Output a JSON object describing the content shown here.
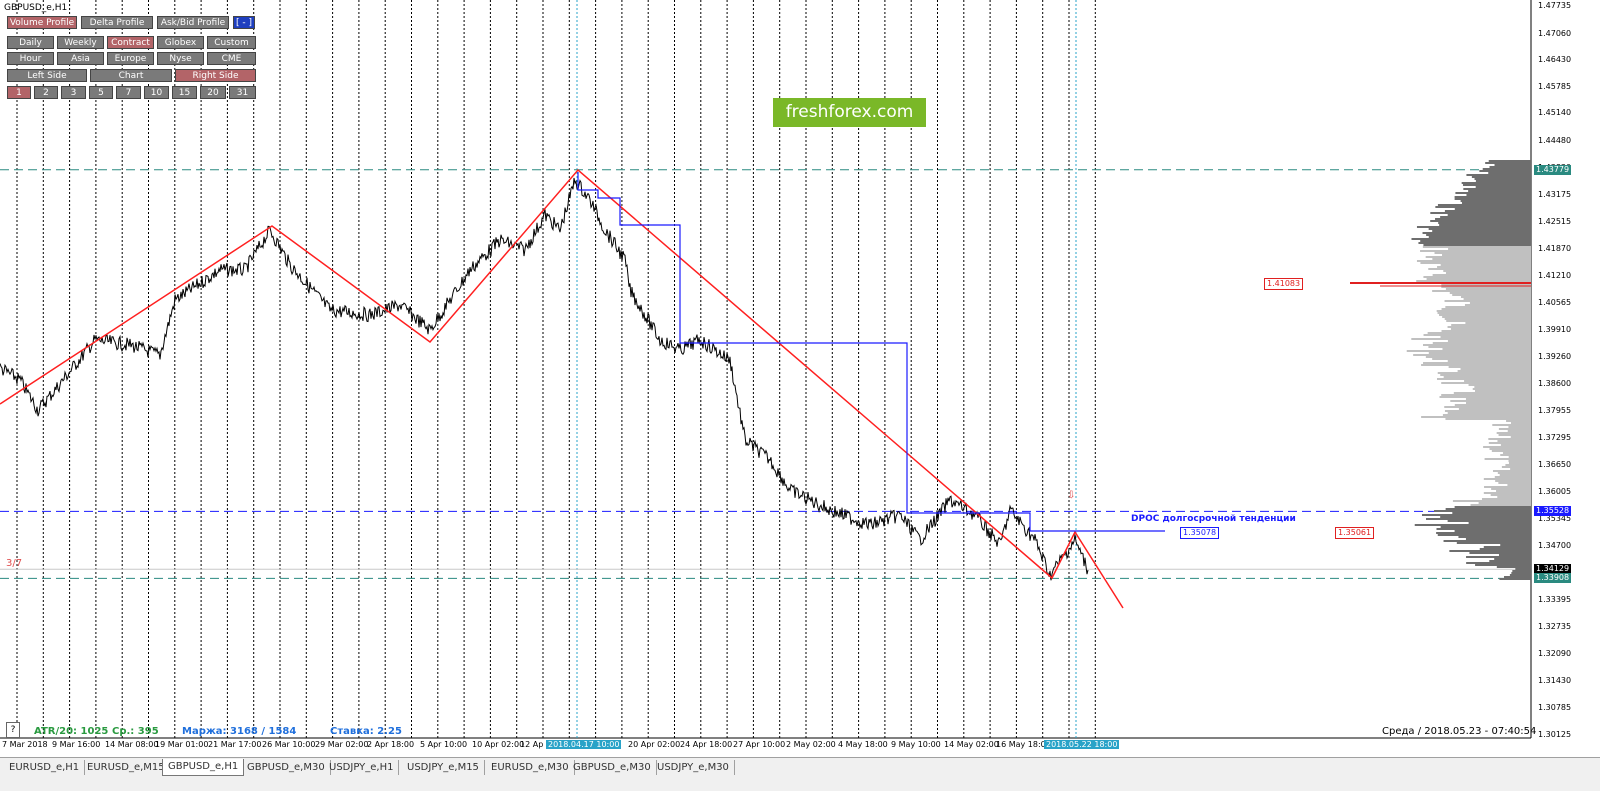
{
  "window": {
    "symbol_label": "GBPUSD_e,H1",
    "bg_color": "#ffffff"
  },
  "toolbar": {
    "row1": [
      {
        "label": "Volume Profile",
        "state": "on"
      },
      {
        "label": "Delta Profile",
        "state": "off"
      },
      {
        "label": "Ask/Bid Profile",
        "state": "off"
      },
      {
        "label": "[ - ]",
        "state": "blue"
      }
    ],
    "row2": [
      {
        "label": "Daily",
        "state": "off"
      },
      {
        "label": "Weekly",
        "state": "off"
      },
      {
        "label": "Contract",
        "state": "on"
      },
      {
        "label": "Globex",
        "state": "off"
      },
      {
        "label": "Custom",
        "state": "off"
      }
    ],
    "row3": [
      {
        "label": "Hour",
        "state": "off"
      },
      {
        "label": "Asia",
        "state": "off"
      },
      {
        "label": "Europe",
        "state": "off"
      },
      {
        "label": "Nyse",
        "state": "off"
      },
      {
        "label": "CME",
        "state": "off"
      }
    ],
    "row4": [
      {
        "label": "Left Side",
        "state": "off"
      },
      {
        "label": "Chart",
        "state": "off"
      },
      {
        "label": "Right Side",
        "state": "on"
      }
    ],
    "row5": [
      {
        "label": "1",
        "state": "on"
      },
      {
        "label": "2",
        "state": "off"
      },
      {
        "label": "3",
        "state": "off"
      },
      {
        "label": "5",
        "state": "off"
      },
      {
        "label": "7",
        "state": "off"
      },
      {
        "label": "10",
        "state": "off"
      },
      {
        "label": "15",
        "state": "off"
      },
      {
        "label": "20",
        "state": "off"
      },
      {
        "label": "31",
        "state": "off"
      }
    ]
  },
  "logo": {
    "text": "freshforex.com",
    "color": "#7ab828"
  },
  "annotations": {
    "dpoc_label": "DPOC долгосрочной тенденции",
    "side_label": "3/7",
    "vpoc_boxes": [
      {
        "value": "1.41083",
        "color": "#e02020"
      },
      {
        "value": "1.35078",
        "color": "#1a1aff"
      },
      {
        "value": "1.35061",
        "color": "#e02020"
      }
    ]
  },
  "price_axis": {
    "labels": [
      "1.47735",
      "1.47060",
      "1.46430",
      "1.45785",
      "1.45140",
      "1.44480",
      "1.43830",
      "1.43175",
      "1.42515",
      "1.41870",
      "1.41210",
      "1.40565",
      "1.39910",
      "1.39260",
      "1.38600",
      "1.37955",
      "1.37295",
      "1.36650",
      "1.36005",
      "1.35345",
      "1.34700",
      "1.34045",
      "1.33395",
      "1.32735",
      "1.32090",
      "1.31430",
      "1.30785",
      "1.30125"
    ],
    "highlights": [
      {
        "value": "1.43779",
        "color": "#2a8a80"
      },
      {
        "value": "1.35528",
        "color": "#1a1aff"
      },
      {
        "value": "1.34129",
        "color": "#000000"
      },
      {
        "value": "1.33908",
        "color": "#2a8a80"
      }
    ]
  },
  "time_axis": {
    "labels": [
      "7 Mar 2018",
      "9 Mar 16:00",
      "14 Mar 08:00",
      "19 Mar 01:00",
      "21 Mar 17:00",
      "26 Mar 10:00",
      "29 Mar 02:00",
      "2 Apr 18:00",
      "5 Apr 10:00",
      "10 Apr 02:00",
      "12 Ap",
      "20 Apr 02:00",
      "24 Apr 18:00",
      "27 Apr 10:00",
      "2 May 02:00",
      "4 May 18:00",
      "9 May 10:00",
      "14 May 02:00",
      "16 May 18:00"
    ],
    "highlights": [
      "2018.04.17 10:00",
      "2018.05.22 18:00"
    ]
  },
  "footer": {
    "atr": "ATR/20: 1025",
    "avg": "Ср.: 395",
    "margin": "Маржа: 3168 / 1584",
    "rate": "Ставка: 2.25",
    "status": "Среда  /  2018.05.23  -  07:40:54",
    "help": "?"
  },
  "tabs": [
    {
      "label": "EURUSD_e,H1",
      "active": false
    },
    {
      "label": "EURUSD_e,M15",
      "active": false
    },
    {
      "label": "GBPUSD_e,H1",
      "active": true
    },
    {
      "label": "GBPUSD_e,M30",
      "active": false
    },
    {
      "label": "USDJPY_e,H1",
      "active": false
    },
    {
      "label": "USDJPY_e,M15",
      "active": false
    },
    {
      "label": "EURUSD_e,M30",
      "active": false
    },
    {
      "label": "GBPUSD_e,M30",
      "active": false
    },
    {
      "label": "USDJPY_e,M30",
      "active": false
    }
  ],
  "chart_data": {
    "type": "line",
    "x_range": [
      "7 Mar 2018",
      "2018.05.23"
    ],
    "ylim": [
      1.30125,
      1.47735
    ],
    "grid": false,
    "colors": {
      "price": "#000000",
      "zigzag": "#ff2020",
      "step": "#1a1aff",
      "teal_level": "#2a8a80",
      "profile_dark": "#6e6e6e",
      "profile_light": "#c0c0c0"
    },
    "levels": [
      {
        "value": 1.43779,
        "style": "dashed",
        "color": "#2a8a80"
      },
      {
        "value": 1.35528,
        "style": "dashed",
        "color": "#1a1aff"
      },
      {
        "value": 1.34129,
        "style": "solid",
        "color": "#c8c8c8"
      },
      {
        "value": 1.33908,
        "style": "dashed",
        "color": "#2a8a80"
      }
    ]
  }
}
